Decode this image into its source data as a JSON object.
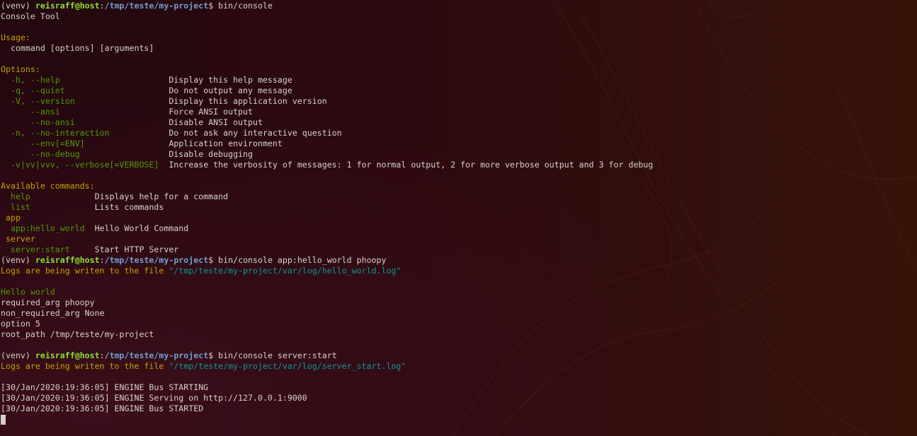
{
  "terminal": {
    "lines": [
      [
        {
          "t": "(venv) ",
          "c": "white"
        },
        {
          "t": "reisraff@host",
          "c": "user"
        },
        {
          "t": ":",
          "c": "white"
        },
        {
          "t": "/tmp/teste/my-project",
          "c": "path"
        },
        {
          "t": "$ bin/console",
          "c": "white"
        }
      ],
      [
        {
          "t": "Console Tool",
          "c": "white"
        }
      ],
      [],
      [
        {
          "t": "Usage:",
          "c": "yellow"
        }
      ],
      [
        {
          "t": "  command [options] [arguments]",
          "c": "white"
        }
      ],
      [],
      [
        {
          "t": "Options:",
          "c": "yellow"
        }
      ],
      [
        {
          "t": "  -h, --help                      ",
          "c": "green"
        },
        {
          "t": "Display this help message",
          "c": "white"
        }
      ],
      [
        {
          "t": "  -q, --quiet                     ",
          "c": "green"
        },
        {
          "t": "Do not output any message",
          "c": "white"
        }
      ],
      [
        {
          "t": "  -V, --version                   ",
          "c": "green"
        },
        {
          "t": "Display this application version",
          "c": "white"
        }
      ],
      [
        {
          "t": "      --ansi                      ",
          "c": "green"
        },
        {
          "t": "Force ANSI output",
          "c": "white"
        }
      ],
      [
        {
          "t": "      --no-ansi                   ",
          "c": "green"
        },
        {
          "t": "Disable ANSI output",
          "c": "white"
        }
      ],
      [
        {
          "t": "  -n, --no-interaction            ",
          "c": "green"
        },
        {
          "t": "Do not ask any interactive question",
          "c": "white"
        }
      ],
      [
        {
          "t": "      --env[=ENV]                 ",
          "c": "green"
        },
        {
          "t": "Application environment",
          "c": "white"
        }
      ],
      [
        {
          "t": "      --no-debug                  ",
          "c": "green"
        },
        {
          "t": "Disable debugging",
          "c": "white"
        }
      ],
      [
        {
          "t": "  -v|vv|vvv, --verbose[=VERBOSE]  ",
          "c": "green"
        },
        {
          "t": "Increase the verbosity of messages: 1 for normal output, 2 for more verbose output and 3 for debug",
          "c": "white"
        }
      ],
      [],
      [
        {
          "t": "Available commands:",
          "c": "yellow"
        }
      ],
      [
        {
          "t": "  help             ",
          "c": "green"
        },
        {
          "t": "Displays help for a command",
          "c": "white"
        }
      ],
      [
        {
          "t": "  list             ",
          "c": "green"
        },
        {
          "t": "Lists commands",
          "c": "white"
        }
      ],
      [
        {
          "t": " app",
          "c": "yellow"
        }
      ],
      [
        {
          "t": "  app:hello_world  ",
          "c": "green"
        },
        {
          "t": "Hello World Command",
          "c": "white"
        }
      ],
      [
        {
          "t": " server",
          "c": "yellow"
        }
      ],
      [
        {
          "t": "  server:start     ",
          "c": "green"
        },
        {
          "t": "Start HTTP Server",
          "c": "white"
        }
      ],
      [
        {
          "t": "(venv) ",
          "c": "white"
        },
        {
          "t": "reisraff@host",
          "c": "user"
        },
        {
          "t": ":",
          "c": "white"
        },
        {
          "t": "/tmp/teste/my-project",
          "c": "path"
        },
        {
          "t": "$ bin/console app:hello_world phoopy",
          "c": "white"
        }
      ],
      [
        {
          "t": "Logs are being writen to the file ",
          "c": "yellow"
        },
        {
          "t": "\"/tmp/teste/my-project/var/log/hello_world.log\"",
          "c": "cyan"
        }
      ],
      [],
      [
        {
          "t": "Hello world",
          "c": "green"
        }
      ],
      [
        {
          "t": "required_arg phoopy",
          "c": "white"
        }
      ],
      [
        {
          "t": "non_required_arg None",
          "c": "white"
        }
      ],
      [
        {
          "t": "option 5",
          "c": "white"
        }
      ],
      [
        {
          "t": "root_path /tmp/teste/my-project",
          "c": "white"
        }
      ],
      [],
      [
        {
          "t": "(venv) ",
          "c": "white"
        },
        {
          "t": "reisraff@host",
          "c": "user"
        },
        {
          "t": ":",
          "c": "white"
        },
        {
          "t": "/tmp/teste/my-project",
          "c": "path"
        },
        {
          "t": "$ bin/console server:start",
          "c": "white"
        }
      ],
      [
        {
          "t": "Logs are being writen to the file ",
          "c": "yellow"
        },
        {
          "t": "\"/tmp/teste/my-project/var/log/server_start.log\"",
          "c": "cyan"
        }
      ],
      [],
      [
        {
          "t": "[30/Jan/2020:19:36:05] ENGINE Bus STARTING",
          "c": "white"
        }
      ],
      [
        {
          "t": "[30/Jan/2020:19:36:05] ENGINE Serving on http://127.0.0.1:9000",
          "c": "white"
        }
      ],
      [
        {
          "t": "[30/Jan/2020:19:36:05] ENGINE Bus STARTED",
          "c": "white"
        }
      ]
    ]
  }
}
